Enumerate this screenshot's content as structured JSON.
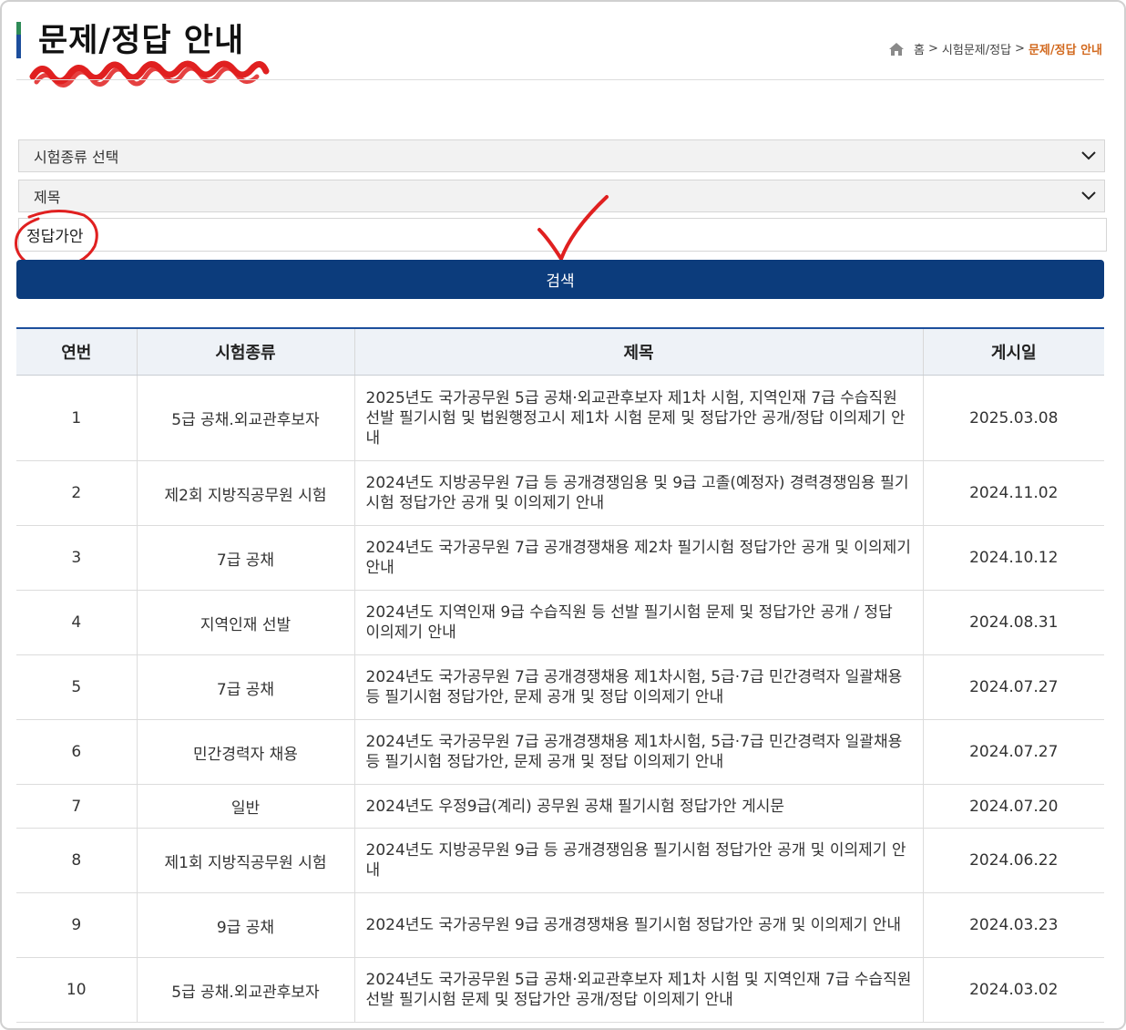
{
  "header": {
    "title": "문제/정답 안내",
    "breadcrumb": {
      "home": "홈",
      "sep": ">",
      "level1": "시험문제/정답",
      "current": "문제/정답 안내"
    }
  },
  "search": {
    "exam_type_select": "시험종류 선택",
    "field_select": "제목",
    "keyword_value": "정답가안",
    "button_label": "검색"
  },
  "table": {
    "headers": [
      "연번",
      "시험종류",
      "제목",
      "게시일"
    ],
    "rows": [
      {
        "no": "1",
        "type": "5급 공채.외교관후보자",
        "title": "2025년도 국가공무원 5급 공채·외교관후보자 제1차 시험, 지역인재 7급 수습직원 선발 필기시험 및 법원행정고시 제1차 시험 문제 및 정답가안 공개/정답 이의제기 안내",
        "date": "2025.03.08"
      },
      {
        "no": "2",
        "type": "제2회 지방직공무원 시험",
        "title": "2024년도 지방공무원 7급 등 공개경쟁임용 및 9급 고졸(예정자) 경력경쟁임용 필기시험 정답가안 공개 및 이의제기 안내",
        "date": "2024.11.02"
      },
      {
        "no": "3",
        "type": "7급 공채",
        "title": "2024년도 국가공무원 7급 공개경쟁채용 제2차 필기시험 정답가안 공개 및 이의제기 안내",
        "date": "2024.10.12"
      },
      {
        "no": "4",
        "type": "지역인재 선발",
        "title": "2024년도 지역인재 9급 수습직원 등 선발 필기시험 문제 및 정답가안 공개 / 정답 이의제기 안내",
        "date": "2024.08.31"
      },
      {
        "no": "5",
        "type": "7급 공채",
        "title": "2024년도 국가공무원 7급 공개경쟁채용 제1차시험, 5급·7급 민간경력자 일괄채용 등 필기시험 정답가안, 문제 공개 및 정답 이의제기 안내",
        "date": "2024.07.27"
      },
      {
        "no": "6",
        "type": "민간경력자 채용",
        "title": "2024년도 국가공무원 7급 공개경쟁채용 제1차시험, 5급·7급 민간경력자 일괄채용 등 필기시험 정답가안, 문제 공개 및 정답 이의제기 안내",
        "date": "2024.07.27"
      },
      {
        "no": "7",
        "type": "일반",
        "title": "2024년도 우정9급(계리) 공무원 공채 필기시험 정답가안 게시문",
        "date": "2024.07.20"
      },
      {
        "no": "8",
        "type": "제1회 지방직공무원 시험",
        "title": "2024년도 지방공무원 9급 등 공개경쟁임용 필기시험 정답가안 공개 및 이의제기 안내",
        "date": "2024.06.22"
      },
      {
        "no": "9",
        "type": "9급 공채",
        "title": "2024년도 국가공무원 9급 공개경쟁채용 필기시험 정답가안 공개 및 이의제기 안내",
        "date": "2024.03.23"
      },
      {
        "no": "10",
        "type": "5급 공채.외교관후보자",
        "title": "2024년도 국가공무원 5급 공채·외교관후보자 제1차 시험 및 지역인재 7급 수습직원 선발 필기시험 문제 및 정답가안 공개/정답 이의제기 안내",
        "date": "2024.03.02"
      }
    ]
  }
}
